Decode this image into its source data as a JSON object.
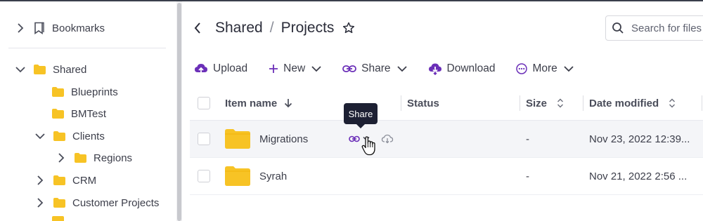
{
  "sidebar": {
    "bookmarks_label": "Bookmarks",
    "shared_label": "Shared",
    "items": [
      {
        "label": "Blueprints"
      },
      {
        "label": "BMTest"
      },
      {
        "label": "Clients"
      },
      {
        "label": "Regions"
      },
      {
        "label": "CRM"
      },
      {
        "label": "Customer Projects"
      }
    ]
  },
  "header": {
    "breadcrumb": [
      "Shared",
      "Projects"
    ],
    "separator": "/",
    "search_placeholder": "Search for files"
  },
  "toolbar": {
    "upload": "Upload",
    "new": "New",
    "share": "Share",
    "download": "Download",
    "more": "More"
  },
  "table": {
    "columns": [
      "Item name",
      "Status",
      "Size",
      "Date modified"
    ],
    "rows": [
      {
        "name": "Migrations",
        "size": "-",
        "date": "Nov 23, 2022 12:39..."
      },
      {
        "name": "Syrah",
        "size": "-",
        "date": "Nov 21, 2022 2:56 ..."
      }
    ]
  },
  "tooltip": "Share",
  "colors": {
    "folder": "#f7c325",
    "accent": "#6b2fb8",
    "tooltip_bg": "#1d2033"
  },
  "icons": [
    "chevron-right-icon",
    "chevron-down-icon",
    "bookmark-icon",
    "folder-icon",
    "back-icon",
    "star-icon",
    "search-icon",
    "upload-icon",
    "plus-icon",
    "link-icon",
    "download-icon",
    "more-icon",
    "sort-down-icon",
    "sort-icon",
    "cloud-download-icon",
    "hand-cursor-icon"
  ]
}
